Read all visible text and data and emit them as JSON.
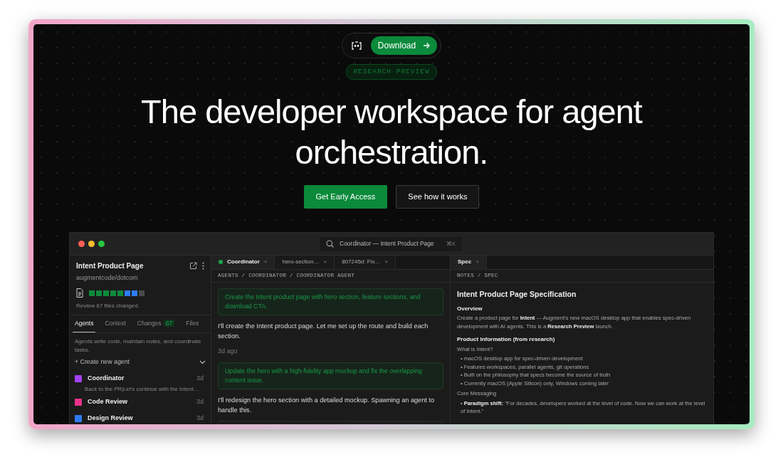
{
  "hero": {
    "download_button": "Download",
    "badge": "RESEARCH PREVIEW",
    "title": "The developer workspace for agent orchestration.",
    "buttons": [
      {
        "label": "Get Early Access",
        "kind": "primary"
      },
      {
        "label": "See how it works",
        "kind": "secondary"
      }
    ]
  },
  "app": {
    "search": {
      "value": "Coordinator — Intent Product Page",
      "shortcut": "⌘K"
    },
    "sidebar": {
      "title": "Intent Product Page",
      "repo": "augmentcode/dotcom",
      "files_bar": [
        {
          "color": "#0f8a3c"
        },
        {
          "color": "#0f8a3c"
        },
        {
          "color": "#0f8a3c"
        },
        {
          "color": "#0f8a3c"
        },
        {
          "color": "#0f8a3c"
        },
        {
          "color": "#2f7cf6"
        },
        {
          "color": "#2f7cf6"
        },
        {
          "color": "#4a4a4a"
        }
      ],
      "files_note": "Review 67 files changed.",
      "tabs": [
        {
          "label": "Agents",
          "selected": true
        },
        {
          "label": "Context",
          "selected": false
        },
        {
          "label": "Changes",
          "count": "67",
          "selected": false
        },
        {
          "label": "Files",
          "selected": false
        }
      ],
      "description": "Agents write code, maintain notes, and coordinate tasks.",
      "create_agent": "+ Create new agent",
      "agents": [
        {
          "name": "Coordinator",
          "time": "3d",
          "preview": "Back to the PR|Let's continue with the Intent…",
          "color": "#a142f4"
        },
        {
          "name": "Code Review",
          "time": "3d",
          "color": "#e8338c"
        },
        {
          "name": "Design Review",
          "time": "3d",
          "color": "#2f7cf6"
        }
      ]
    },
    "center": {
      "tabs": [
        {
          "label": "Coordinator",
          "selected": true,
          "dot": true,
          "close": "×"
        },
        {
          "label": "hero-section…",
          "selected": false,
          "close": "×"
        },
        {
          "label": "807245d: Fix…",
          "selected": false,
          "close": "×"
        }
      ],
      "breadcrumb": "AGENTS / COORDINATOR / COORDINATOR AGENT",
      "messages": [
        {
          "kind": "prompt",
          "text": "Create the Intent product page with hero section, feature sections, and download CTA."
        },
        {
          "kind": "reply",
          "text": "I'll create the Intent product page. Let me set up the route and build each section."
        },
        {
          "kind": "time",
          "text": "3d ago"
        },
        {
          "kind": "prompt",
          "text": "Update the hero with a high-fidelity app mockup and fix the overlapping content issue."
        },
        {
          "kind": "reply",
          "text": "I'll redesign the hero section with a detailed mockup. Spawning an agent to handle this."
        }
      ]
    },
    "spec": {
      "tabs": [
        {
          "label": "Spec",
          "selected": true,
          "close": "×"
        }
      ],
      "breadcrumb": "NOTES / SPEC",
      "blocks": [
        {
          "kind": "h1",
          "text": "Intent Product Page Specification"
        },
        {
          "kind": "h2",
          "text": "Overview"
        },
        {
          "kind": "p",
          "text": "Create a product page for **Intent** — Augment's new macOS desktop app that enables spec-driven development with AI agents. This is a **Research Preview** launch."
        },
        {
          "kind": "h2",
          "text": "Product Information (from research)"
        },
        {
          "kind": "label",
          "text": "What is Intent?"
        },
        {
          "kind": "bullet",
          "text": "• macOS desktop app for spec-driven development"
        },
        {
          "kind": "bullet",
          "text": "• Features workspaces, parallel agents, git operations"
        },
        {
          "kind": "bullet",
          "text": "• Built on the philosophy that specs become the source of truth"
        },
        {
          "kind": "bullet",
          "text": "• Currently macOS (Apple Silicon) only, Windows coming later"
        },
        {
          "kind": "label",
          "text": "Core Messaging"
        },
        {
          "kind": "bullet",
          "text": "• **Paradigm shift:** \"For decades, developers worked at the level of code. Now we can work at the level of Intent.\""
        }
      ]
    }
  }
}
